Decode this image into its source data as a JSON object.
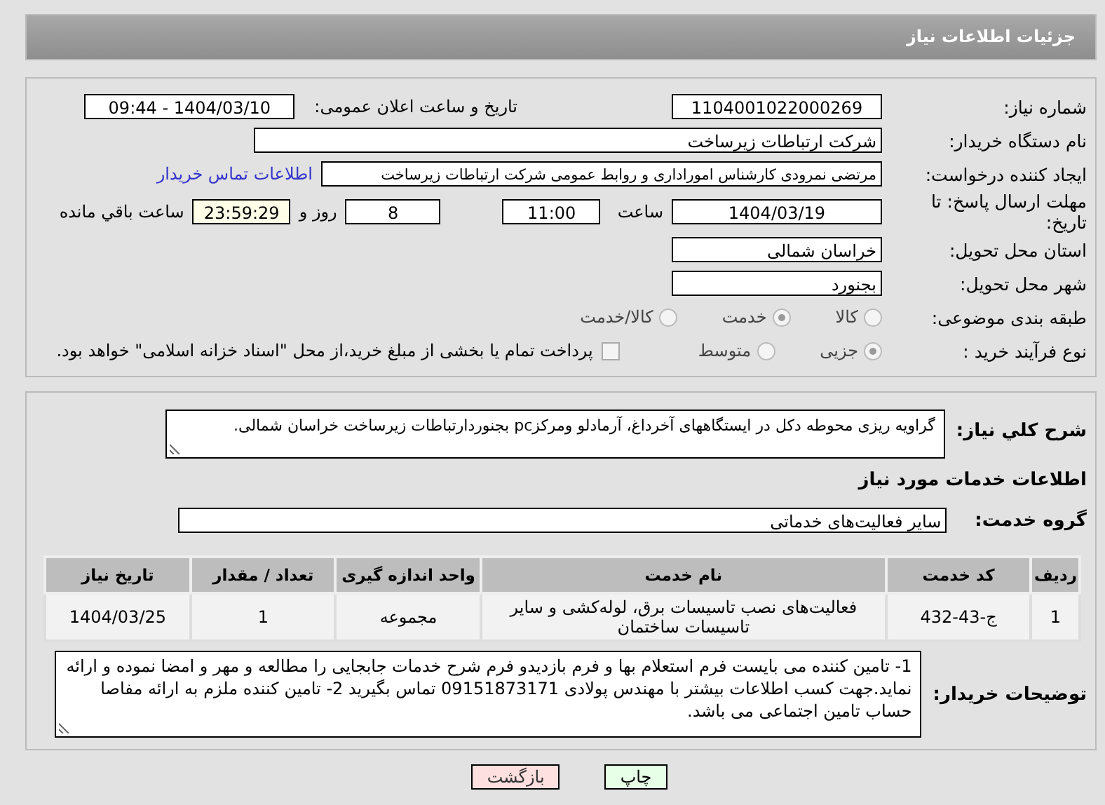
{
  "page_title": "جزئیات اطلاعات نیاز",
  "need_number": {
    "label": "شماره نیاز:",
    "value": "1104001022000269"
  },
  "announce": {
    "label": "تاریخ و ساعت اعلان عمومی:",
    "value": "1404/03/10 - 09:44"
  },
  "buyer_org": {
    "label": "نام دستگاه خریدار:",
    "value": "شرکت ارتباطات زیرساخت"
  },
  "requester": {
    "label": "ایجاد کننده درخواست:",
    "value": "مرتضی نمرودی کارشناس اموراداری و روابط عمومی شرکت ارتباطات زیرساخت",
    "link": "اطلاعات تماس خریدار"
  },
  "deadline": {
    "label": "مهلت ارسال پاسخ: تا تاریخ:",
    "date": "1404/03/19",
    "time_label": "ساعت",
    "time": "11:00",
    "days": "8",
    "days_label": "روز و",
    "remaining": "23:59:29",
    "remaining_label": "ساعت باقي مانده"
  },
  "province": {
    "label": "استان محل تحویل:",
    "value": "خراسان شمالی"
  },
  "city": {
    "label": "شهر محل تحویل:",
    "value": "بجنورد"
  },
  "category": {
    "label": "طبقه بندی موضوعی:",
    "options": [
      {
        "label": "کالا",
        "selected": false
      },
      {
        "label": "خدمت",
        "selected": true
      },
      {
        "label": "کالا/خدمت",
        "selected": false
      }
    ]
  },
  "purchase_type": {
    "label": "نوع فرآیند خرید :",
    "options": [
      {
        "label": "جزیی",
        "selected": true
      },
      {
        "label": "متوسط",
        "selected": false
      }
    ],
    "payment": {
      "checked": false,
      "text": "پرداخت تمام یا بخشی از مبلغ خرید،از محل \"اسناد خزانه اسلامی\" خواهد بود."
    }
  },
  "description": {
    "label": "شرح کلي نياز:",
    "value": "گراویه ریزی محوطه دکل در ایستگاههای آخرداغ، آرمادلو ومرکزpc بجنوردارتباطات زیرساخت خراسان شمالی."
  },
  "services_heading": "اطلاعات خدمات مورد نياز",
  "service_group": {
    "label": "گروه خدمت:",
    "value": "سایر فعالیت‌های خدماتی"
  },
  "table": {
    "columns": [
      "ردیف",
      "کد خدمت",
      "نام خدمت",
      "واحد اندازه گیری",
      "تعداد / مقدار",
      "تاریخ نیاز"
    ],
    "rows": [
      [
        "1",
        "ج-43-432",
        "فعالیت‌های نصب تاسیسات برق، لوله‌کشی و سایر تاسیسات ساختمان",
        "مجموعه",
        "1",
        "1404/03/25"
      ]
    ]
  },
  "buyer_notes": {
    "label": "توضیحات خریدار:",
    "value": "1- تامین کننده می بایست فرم استعلام بها و فرم بازدیدو فرم شرح خدمات جابجایی را مطالعه و مهر و امضا نموده و ارائه نماید.جهت کسب اطلاعات بیشتر با مهندس پولادی 09151873171 تماس بگیرید 2- تامین کننده ملزم به ارائه مفاصا حساب تامین اجتماعی می باشد."
  },
  "buttons": [
    {
      "kind": "print",
      "label": "چاپ"
    },
    {
      "kind": "back",
      "label": "بازگشت"
    }
  ]
}
